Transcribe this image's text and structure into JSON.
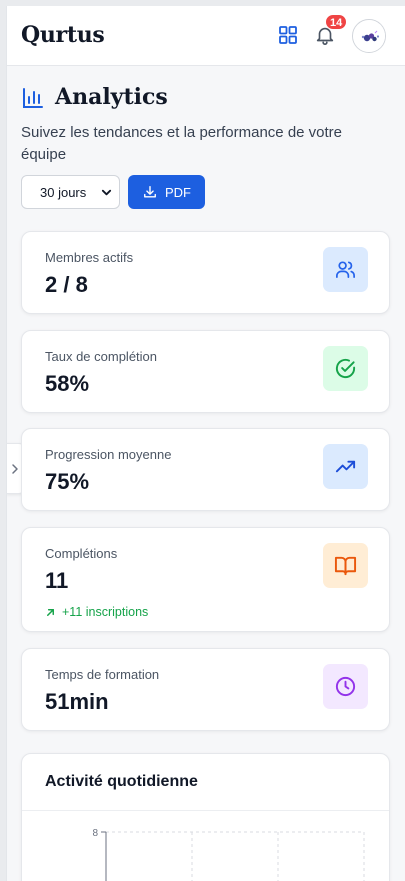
{
  "app": {
    "brand": "Qurtus"
  },
  "header": {
    "notification_count": "14",
    "apps_icon": "grid-icon",
    "bell_icon": "bell-icon"
  },
  "page": {
    "title": "Analytics",
    "title_icon": "bar-chart-icon",
    "subtitle": "Suivez les tendances et la performance de votre équipe"
  },
  "controls": {
    "period": {
      "value": "30 jours",
      "options": [
        "30 jours"
      ]
    },
    "pdf_label": "PDF"
  },
  "stats": [
    {
      "label": "Membres actifs",
      "value": "2 / 8",
      "icon": "users-icon",
      "color": "#2563eb",
      "bg": "#dbeafe"
    },
    {
      "label": "Taux de complétion",
      "value": "58%",
      "icon": "check-circle-icon",
      "color": "#16a34a",
      "bg": "#dcfce7"
    },
    {
      "label": "Progression moyenne",
      "value": "75%",
      "icon": "trending-up-icon",
      "color": "#1d4ed8",
      "bg": "#dbeafe"
    },
    {
      "label": "Complétions",
      "value": "11",
      "icon": "book-open-icon",
      "color": "#ea580c",
      "bg": "#ffedd5",
      "trend": "+11 inscriptions"
    },
    {
      "label": "Temps de formation",
      "value": "51min",
      "icon": "clock-icon",
      "color": "#9333ea",
      "bg": "#f3e8ff"
    }
  ],
  "activity": {
    "title": "Activité quotidienne",
    "chart_data": {
      "type": "line",
      "title": "Activité quotidienne",
      "y_tick_labels": [
        "8"
      ],
      "ylim": [
        0,
        8
      ],
      "grid": true
    }
  }
}
